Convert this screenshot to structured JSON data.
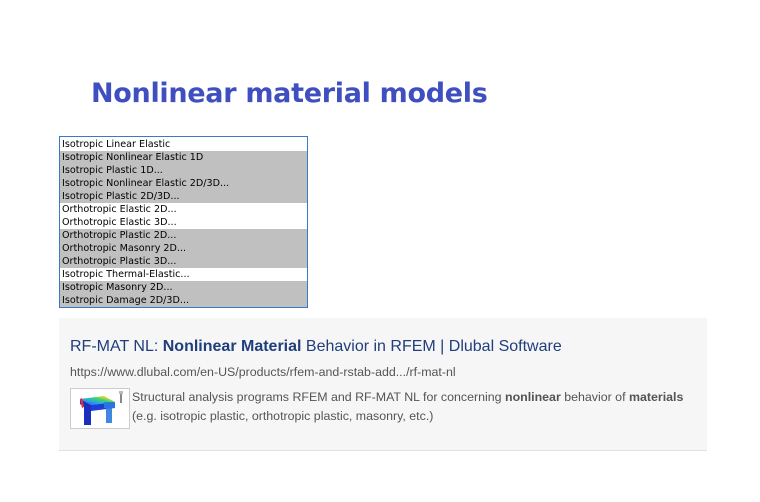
{
  "title": "Nonlinear material models",
  "materials_list": {
    "items": [
      {
        "label": "Isotropic Linear Elastic",
        "highlighted": false
      },
      {
        "label": "Isotropic Nonlinear Elastic 1D",
        "highlighted": true
      },
      {
        "label": "Isotropic Plastic 1D...",
        "highlighted": true
      },
      {
        "label": "Isotropic Nonlinear Elastic 2D/3D...",
        "highlighted": true
      },
      {
        "label": "Isotropic Plastic 2D/3D...",
        "highlighted": true
      },
      {
        "label": "Orthotropic Elastic 2D...",
        "highlighted": false
      },
      {
        "label": "Orthotropic Elastic 3D...",
        "highlighted": false
      },
      {
        "label": "Orthotropic Plastic 2D...",
        "highlighted": true
      },
      {
        "label": "Orthotropic Masonry 2D...",
        "highlighted": true
      },
      {
        "label": "Orthotropic Plastic 3D...",
        "highlighted": true
      },
      {
        "label": "Isotropic Thermal-Elastic...",
        "highlighted": false
      },
      {
        "label": "Isotropic Masonry 2D...",
        "highlighted": true
      },
      {
        "label": "Isotropic Damage 2D/3D...",
        "highlighted": true
      }
    ],
    "highlight_color": "#c0c0c0",
    "border_color": "#3c78c4"
  },
  "search_result": {
    "title_prefix": "RF-MAT NL: ",
    "title_bold": "Nonlinear Material",
    "title_suffix": " Behavior in RFEM | Dlubal Software",
    "url": "https://www.dlubal.com/en-US/products/rfem-and-rstab-add.../rf-mat-nl",
    "snippet_part1": "Structural analysis programs RFEM and RF-MAT NL for concerning ",
    "snippet_bold1": "nonlinear",
    "snippet_part2": " behavior of ",
    "snippet_bold2": "materials",
    "snippet_part3": " (e.g. isotropic plastic, orthotropic plastic, masonry, etc.)",
    "thumbnail_icon": "fem-model-thumbnail-icon",
    "title_color": "#1f3e7c"
  },
  "accent_color": "#3f4fc0"
}
